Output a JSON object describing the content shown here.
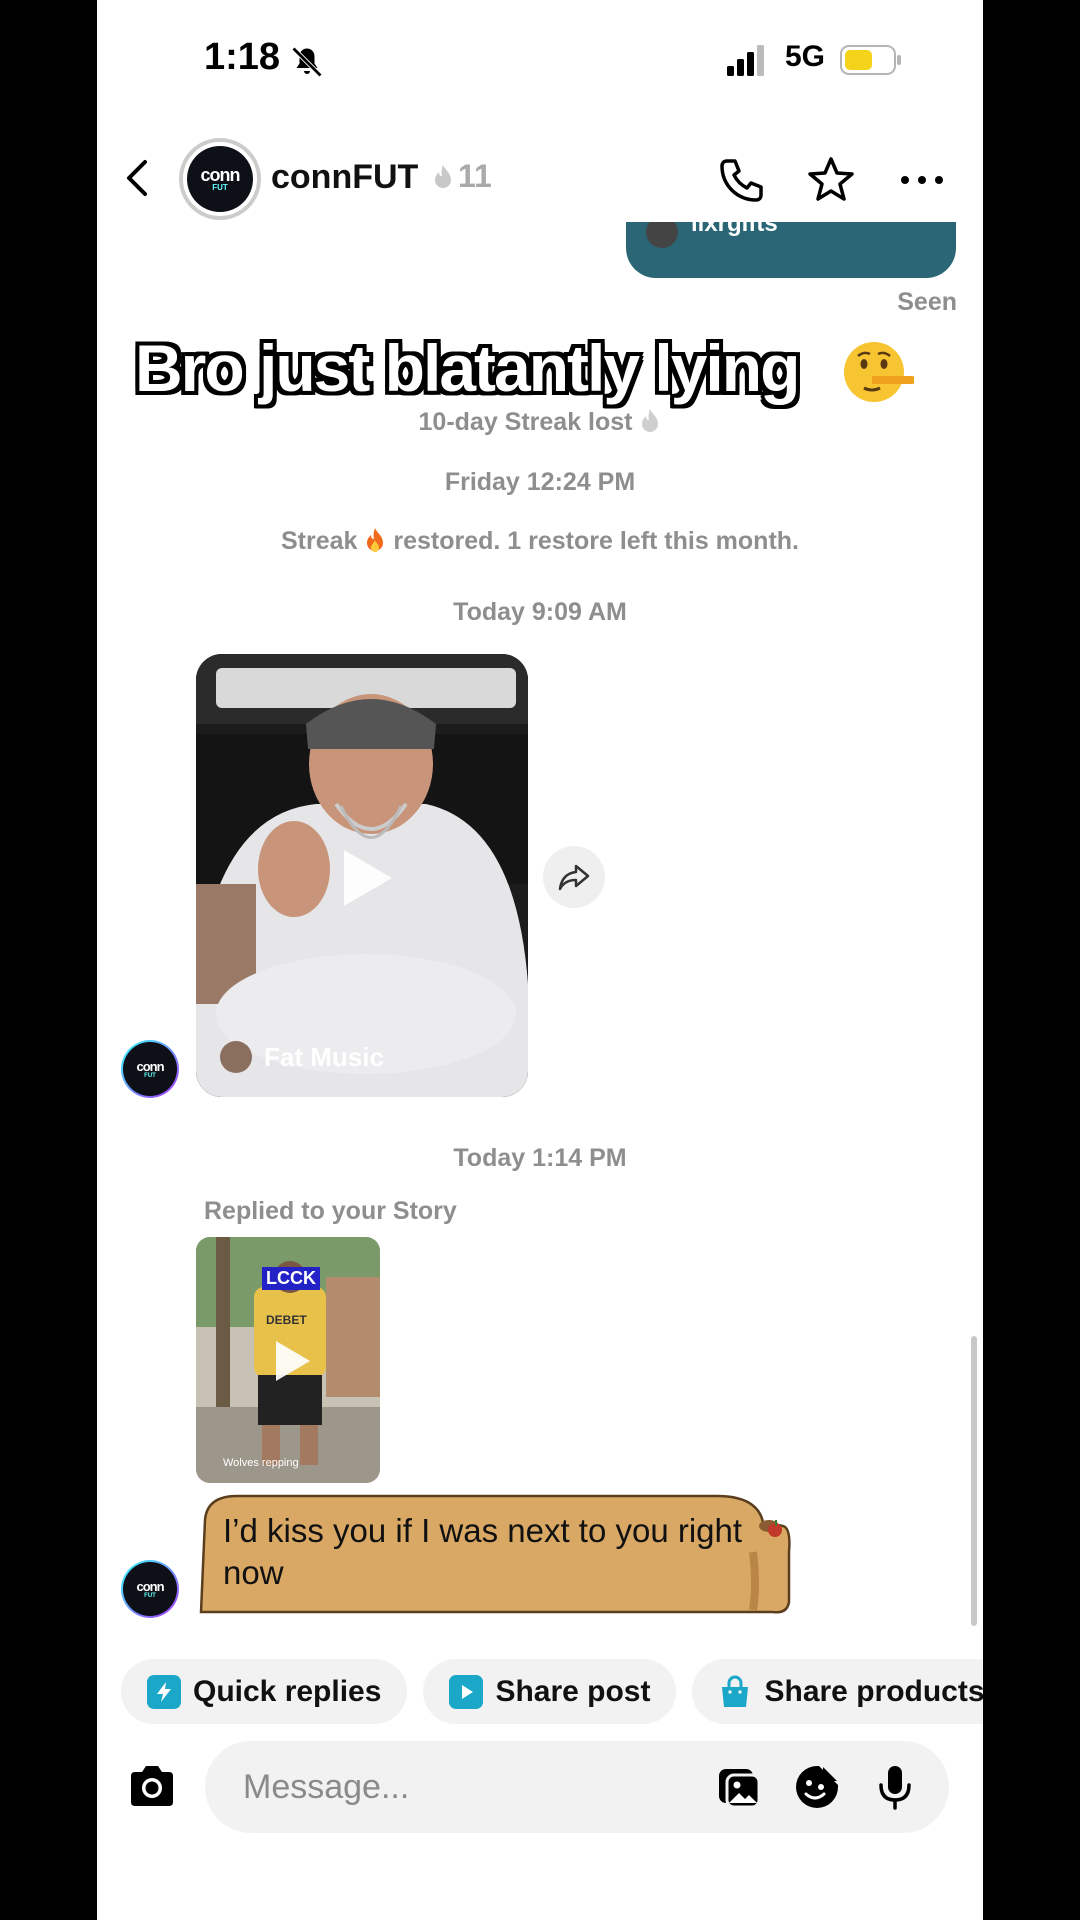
{
  "status_bar": {
    "time": "1:18",
    "network": "5G"
  },
  "header": {
    "name": "connFUT",
    "streak_count": "11",
    "avatar_text": "conn",
    "avatar_sub": "FUT"
  },
  "top_bubble": {
    "text": "lixrgifts"
  },
  "seen_label": "Seen",
  "overlay_caption": "Bro just blatantly lying",
  "system_messages": {
    "streak_lost": "10-day Streak lost",
    "friday_time": "Friday 12:24 PM",
    "streak_restored_prefix": "Streak",
    "streak_restored_suffix": "restored. 1 restore left this month.",
    "today_morning": "Today 9:09 AM",
    "today_afternoon": "Today 1:14 PM"
  },
  "video_message": {
    "label": "Fat Music"
  },
  "story_reply": {
    "label": "Replied to your Story",
    "thumb_tag": "LCCK",
    "thumb_caption": "Wolves repping",
    "shirt_text": "DEBET",
    "message": "I’d kiss you if I was next to you right now"
  },
  "chips": [
    {
      "label": "Quick replies",
      "icon": "lightning-icon"
    },
    {
      "label": "Share post",
      "icon": "play-square-icon"
    },
    {
      "label": "Share products",
      "icon": "shopping-bag-icon"
    }
  ],
  "composer": {
    "placeholder": "Message..."
  },
  "colors": {
    "accent": "#1aa7c8",
    "top_bubble": "#2a6675",
    "capy_bubble": "#d9a865",
    "system_text": "#8e8e8e"
  }
}
